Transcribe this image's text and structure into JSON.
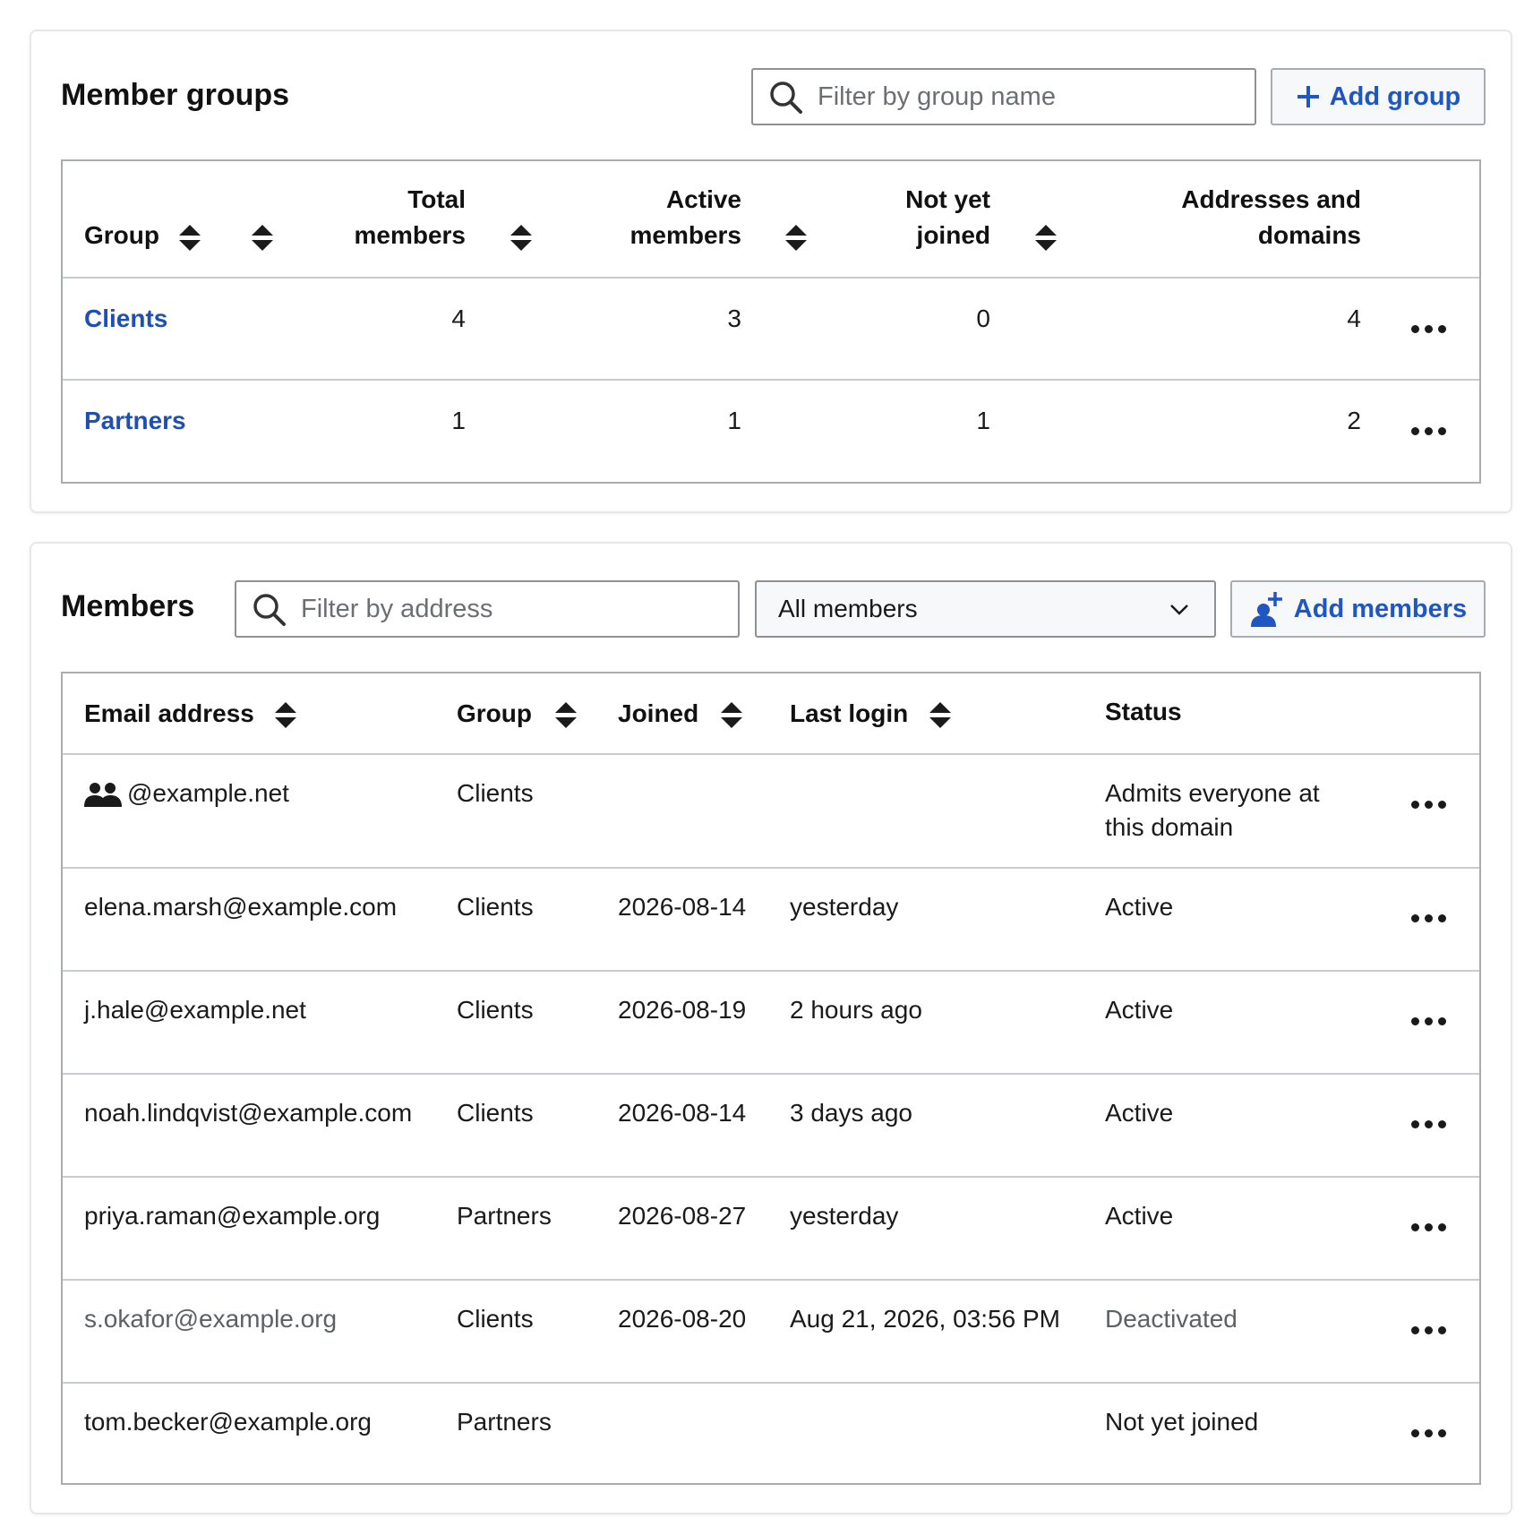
{
  "groups_section": {
    "title": "Member groups",
    "filter_placeholder": "Filter by group name",
    "add_button": "Add group",
    "columns": {
      "group": "Group",
      "total_1": "Total",
      "total_2": "members",
      "active_1": "Active",
      "active_2": "members",
      "notyet_1": "Not yet",
      "notyet_2": "joined",
      "addr_1": "Addresses and",
      "addr_2": "domains"
    },
    "rows": [
      {
        "name": "Clients",
        "total": "4",
        "active": "3",
        "not_joined": "0",
        "addresses": "4"
      },
      {
        "name": "Partners",
        "total": "1",
        "active": "1",
        "not_joined": "1",
        "addresses": "2"
      }
    ]
  },
  "members_section": {
    "title": "Members",
    "filter_placeholder": "Filter by address",
    "filter_select": "All members",
    "add_button": "Add members",
    "columns": {
      "email": "Email address",
      "group": "Group",
      "joined": "Joined",
      "last_login": "Last login",
      "status": "Status"
    },
    "rows": [
      {
        "email": "@example.net",
        "group": "Clients",
        "joined": "",
        "last_login": "",
        "status_1": "Admits everyone at",
        "status_2": "this domain"
      },
      {
        "email": "elena.marsh@example.com",
        "group": "Clients",
        "joined": "2026-08-14",
        "last_login": "yesterday",
        "status_1": "Active",
        "status_2": ""
      },
      {
        "email": "j.hale@example.net",
        "group": "Clients",
        "joined": "2026-08-19",
        "last_login": "2 hours ago",
        "status_1": "Active",
        "status_2": ""
      },
      {
        "email": "noah.lindqvist@example.com",
        "group": "Clients",
        "joined": "2026-08-14",
        "last_login": "3 days ago",
        "status_1": "Active",
        "status_2": ""
      },
      {
        "email": "priya.raman@example.org",
        "group": "Partners",
        "joined": "2026-08-27",
        "last_login": "yesterday",
        "status_1": "Active",
        "status_2": ""
      },
      {
        "email": "s.okafor@example.org",
        "group": "Clients",
        "joined": "2026-08-20",
        "last_login": "Aug 21, 2026, 03:56 PM",
        "status_1": "Deactivated",
        "status_2": ""
      },
      {
        "email": "tom.becker@example.org",
        "group": "Partners",
        "joined": "",
        "last_login": "",
        "status_1": "Not yet joined",
        "status_2": ""
      }
    ]
  },
  "icons": {
    "search": "search-icon",
    "plus": "plus-icon",
    "add_person": "add-person-icon",
    "chevron": "chevron-down-icon",
    "sort": "sort-icon",
    "more": "more-options-icon",
    "domain_group": "people-group-icon"
  },
  "colors": {
    "link": "#1f4fb0",
    "button_text": "#1f56c1",
    "muted_text": "#5c6166"
  }
}
